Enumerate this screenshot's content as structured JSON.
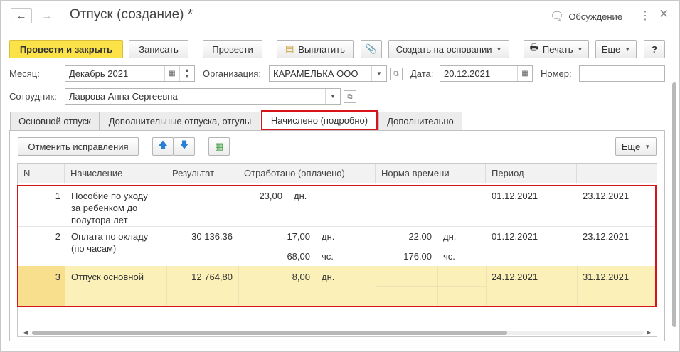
{
  "window": {
    "title": "Отпуск (создание) *",
    "discussion_label": "Обсуждение"
  },
  "toolbar": {
    "post_close": "Провести и закрыть",
    "save": "Записать",
    "post": "Провести",
    "pay": "Выплатить",
    "create_based": "Создать на основании",
    "print": "Печать",
    "more": "Еще",
    "help": "?"
  },
  "form": {
    "month_label": "Месяц:",
    "month_value": "Декабрь 2021",
    "org_label": "Организация:",
    "org_value": "КАРАМЕЛЬКА ООО",
    "date_label": "Дата:",
    "date_value": "20.12.2021",
    "number_label": "Номер:",
    "number_value": "",
    "employee_label": "Сотрудник:",
    "employee_value": "Лаврова Анна Сергеевна"
  },
  "tabs": [
    {
      "label": "Основной отпуск",
      "active": false
    },
    {
      "label": "Дополнительные отпуска, отгулы",
      "active": false
    },
    {
      "label": "Начислено (подробно)",
      "active": true
    },
    {
      "label": "Дополнительно",
      "active": false
    }
  ],
  "grid_toolbar": {
    "cancel_corrections": "Отменить исправления",
    "more": "Еще"
  },
  "table": {
    "columns": [
      "N",
      "Начисление",
      "Результат",
      "Отработано (оплачено)",
      "Норма времени",
      "Период",
      ""
    ],
    "rows": [
      {
        "n": "1",
        "accrual": [
          "Пособие по уходу",
          "за ребенком до",
          "полутора лет"
        ],
        "result": "",
        "worked": [
          {
            "value": "23,00",
            "unit": "дн."
          }
        ],
        "norm": [],
        "period_from": "01.12.2021",
        "period_to": "23.12.2021"
      },
      {
        "n": "2",
        "accrual": [
          "Оплата по окладу",
          "(по часам)"
        ],
        "result": "30 136,36",
        "worked": [
          {
            "value": "17,00",
            "unit": "дн."
          },
          {
            "value": "68,00",
            "unit": "чс."
          }
        ],
        "norm": [
          {
            "value": "22,00",
            "unit": "дн."
          },
          {
            "value": "176,00",
            "unit": "чс."
          }
        ],
        "period_from": "01.12.2021",
        "period_to": "23.12.2021"
      },
      {
        "n": "3",
        "accrual": [
          "Отпуск основной"
        ],
        "result": "12 764,80",
        "worked": [
          {
            "value": "8,00",
            "unit": "дн."
          }
        ],
        "norm": [],
        "period_from": "24.12.2021",
        "period_to": "31.12.2021"
      }
    ]
  },
  "colors": {
    "primary_button": "#fbe249",
    "highlight_row": "#fbf0b8",
    "highlight_border": "#d8141b"
  }
}
